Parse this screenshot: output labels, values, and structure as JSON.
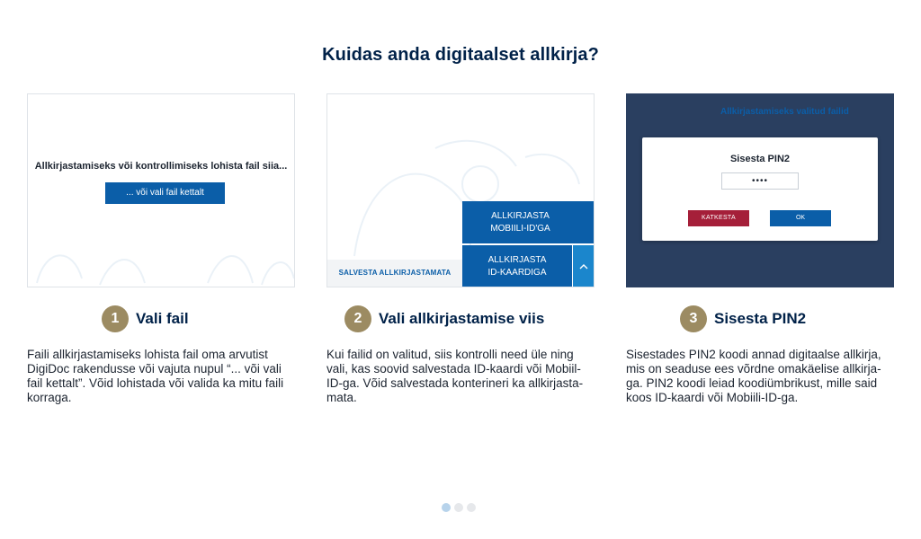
{
  "page_title": "Kuidas anda digitaalset allkirja?",
  "cards": {
    "select_file": {
      "drop_text": "Allkirjastamiseks või kontrollimiseks lohista fail siia...",
      "choose_button": "... või vali fail kettalt"
    },
    "choose_method": {
      "save_unsigned": "SALVESTA ALLKIRJASTAMATA",
      "sign_mobile_line1": "ALLKIRJASTA",
      "sign_mobile_line2": "MOBIILI-ID'GA",
      "sign_idcard_line1": "ALLKIRJASTA",
      "sign_idcard_line2": "ID-KAARDIGA",
      "chevron_icon": "chevron-up-icon"
    },
    "enter_pin": {
      "header": "Allkirjastamiseks valitud failid",
      "modal_title": "Sisesta PIN2",
      "pin_value": "••••",
      "cancel_button": "KATKESTA",
      "ok_button": "OK"
    }
  },
  "steps": [
    {
      "number": "1",
      "title": "Vali fail",
      "description": "Faili allkirjastamiseks lohista fail oma arvutist\nDigiDoc rakendusse või vajuta nupul “... või vali\nfail kettalt”. Võid lohistada või valida ka mitu faili\nkorraga."
    },
    {
      "number": "2",
      "title": "Vali allkirjastamise viis",
      "description": "Kui failid on valitud, siis kontrolli need üle ning\nvali, kas soovid salvestada ID-kaardi või Mobiil-\nID-ga. Võid salvestada konterineri ka allkirjasta-\nmata."
    },
    {
      "number": "3",
      "title": "Sisesta PIN2",
      "description": "Sisestades PIN2 koodi annad digitaalse allkirja,\nmis on seaduse ees võrdne omakäelise allkirja-\nga. PIN2 koodi leiad koodiümbrikust, mille said\nkoos ID-kaardi või Mobiili-ID-ga."
    }
  ],
  "pagination": {
    "total": 3,
    "active": 1
  },
  "colors": {
    "primary": "#0b5ea8",
    "title": "#002148",
    "badge": "#9c8b62",
    "danger": "#a51f39",
    "dark_panel": "#2a3f60"
  }
}
